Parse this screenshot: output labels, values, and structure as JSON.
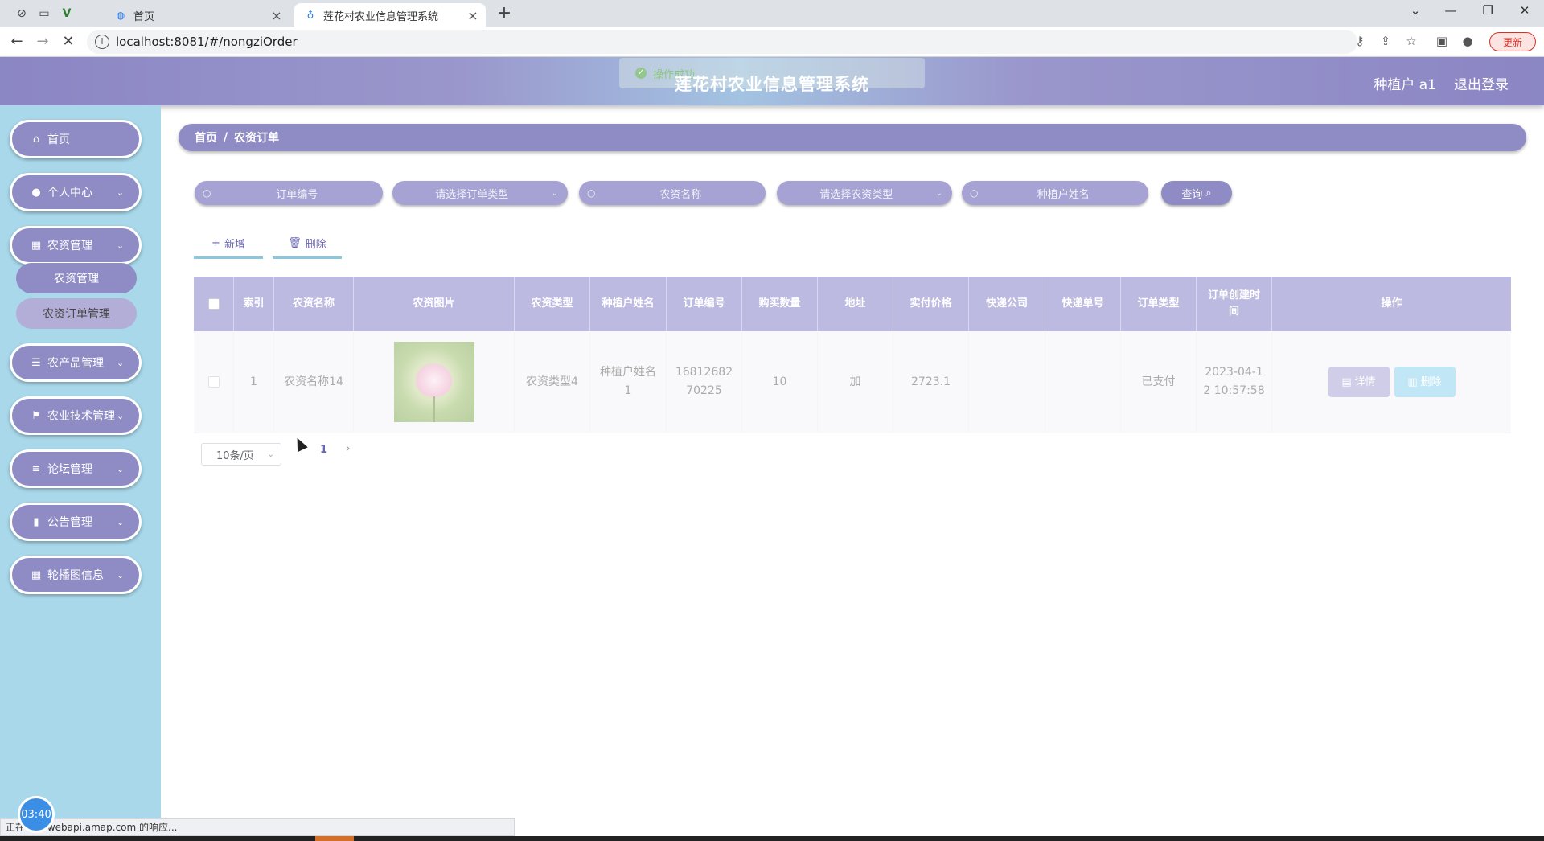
{
  "browser": {
    "tabs": [
      {
        "title": "首页",
        "active": false
      },
      {
        "title": "莲花村农业信息管理系统",
        "active": true
      }
    ],
    "url": "localhost:8081/#/nongziOrder",
    "update_label": "更新",
    "status_text": "正在等待 webapi.amap.com 的响应...",
    "clock": "03:40"
  },
  "header": {
    "title": "莲花村农业信息管理系统",
    "toast": "操作成功",
    "user": "种植户 a1",
    "logout": "退出登录"
  },
  "sidebar": {
    "items": [
      {
        "label": "首页",
        "icon": "home-icon"
      },
      {
        "label": "个人中心",
        "icon": "user-icon"
      },
      {
        "label": "农资管理",
        "icon": "grid-icon"
      },
      {
        "label": "农产品管理",
        "icon": "sliders-icon"
      },
      {
        "label": "农业技术管理",
        "icon": "flag-icon"
      },
      {
        "label": "论坛管理",
        "icon": "list-icon"
      },
      {
        "label": "公告管理",
        "icon": "bar-chart-icon"
      },
      {
        "label": "轮播图信息",
        "icon": "grid-icon"
      }
    ],
    "submenu": [
      {
        "label": "农资管理"
      },
      {
        "label": "农资订单管理"
      }
    ]
  },
  "breadcrumb": {
    "home": "首页",
    "current": "农资订单"
  },
  "filters": {
    "order_no": "订单编号",
    "order_type": "请选择订单类型",
    "nongzi_name": "农资名称",
    "nongzi_type": "请选择农资类型",
    "farmer_name": "种植户姓名",
    "query": "查询"
  },
  "actions": {
    "add": "新增",
    "delete": "删除"
  },
  "table": {
    "columns": [
      "索引",
      "农资名称",
      "农资图片",
      "农资类型",
      "种植户姓名",
      "订单编号",
      "购买数量",
      "地址",
      "实付价格",
      "快递公司",
      "快递单号",
      "订单类型",
      "订单创建时间",
      "操作"
    ],
    "rows": [
      {
        "index": "1",
        "name": "农资名称14",
        "type": "农资类型4",
        "farmer": "种植户姓名1",
        "order_no": "1681268270225",
        "quantity": "10",
        "address": "加",
        "price": "2723.1",
        "courier": "",
        "tracking": "",
        "order_type": "已支付",
        "created": "2023-04-12 10:57:58",
        "detail": "详情",
        "delete": "删除"
      }
    ]
  },
  "pagination": {
    "page_size": "10条/页",
    "current_page": "1"
  },
  "colors": {
    "header_purple": "#8f8cc5",
    "sidebar_blue": "#a8d8ea",
    "detail_btn": "#a8a5d6",
    "delete_btn": "#8fd3ee"
  }
}
